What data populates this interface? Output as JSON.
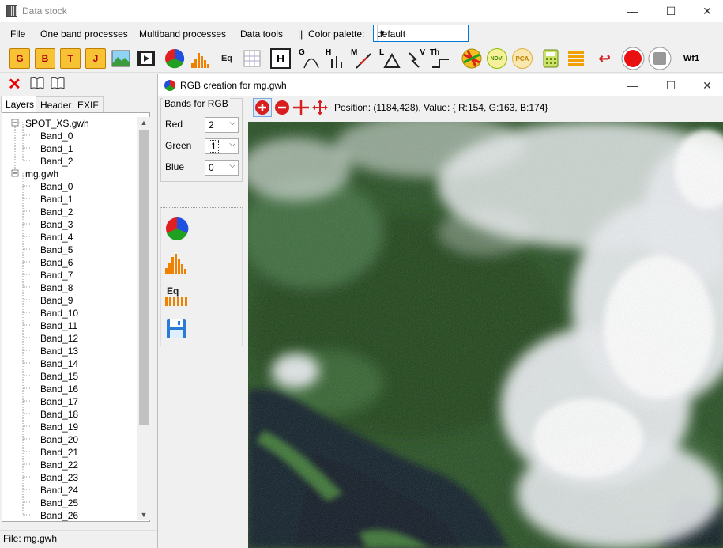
{
  "window": {
    "title": "Data stock",
    "minimize": "—",
    "maximize": "☐",
    "close": "✕"
  },
  "menu": {
    "items": [
      "File",
      "One band processes",
      "Multiband processes",
      "Data tools",
      "||"
    ],
    "palette_label": "Color palette:",
    "palette_value": "default"
  },
  "toolbar": {
    "buttons": [
      "G",
      "B",
      "T",
      "J",
      "",
      "",
      "",
      "",
      "Eq",
      "",
      "H",
      "G",
      "H",
      "M",
      "L",
      "V",
      "Th",
      "",
      "NDVI",
      "PCA",
      "",
      "",
      "",
      "",
      "",
      "Wf1"
    ],
    "icons": [
      "g-file-icon",
      "b-file-icon",
      "t-file-icon",
      "j-file-icon",
      "image-icon",
      "film-icon",
      "rgb-icon",
      "histogram-icon",
      "equalize-icon",
      "grid-icon",
      "h-icon",
      "gauss-icon",
      "h-threshold-icon",
      "m-curve-icon",
      "triangle-icon",
      "lightning-icon",
      "threshold-icon",
      "classify-icon",
      "ndvi-icon",
      "pca-icon",
      "calculator-icon",
      "list-icon",
      "undo-icon",
      "record-icon",
      "stop-icon",
      "wf-icon"
    ]
  },
  "left_panel": {
    "tabs": [
      "Layers",
      "Header",
      "EXIF"
    ],
    "tree": [
      {
        "label": "SPOT_XS.gwh",
        "children": [
          "Band_0",
          "Band_1",
          "Band_2"
        ]
      },
      {
        "label": "mg.gwh",
        "children": [
          "Band_0",
          "Band_1",
          "Band_2",
          "Band_3",
          "Band_4",
          "Band_5",
          "Band_6",
          "Band_7",
          "Band_8",
          "Band_9",
          "Band_10",
          "Band_11",
          "Band_12",
          "Band_13",
          "Band_14",
          "Band_15",
          "Band_16",
          "Band_17",
          "Band_18",
          "Band_19",
          "Band_20",
          "Band_21",
          "Band_22",
          "Band_23",
          "Band_24",
          "Band_25",
          "Band_26"
        ]
      }
    ],
    "status": "File: mg.gwh"
  },
  "rgb_window": {
    "title": "RGB creation for mg.gwh",
    "bands_legend": "Bands for RGB",
    "red_label": "Red",
    "red_value": "2",
    "green_label": "Green",
    "green_value": "1",
    "blue_label": "Blue",
    "blue_value": "0",
    "position_text": "Position: (1184,428), Value: { R:154, G:163, B:174}"
  }
}
